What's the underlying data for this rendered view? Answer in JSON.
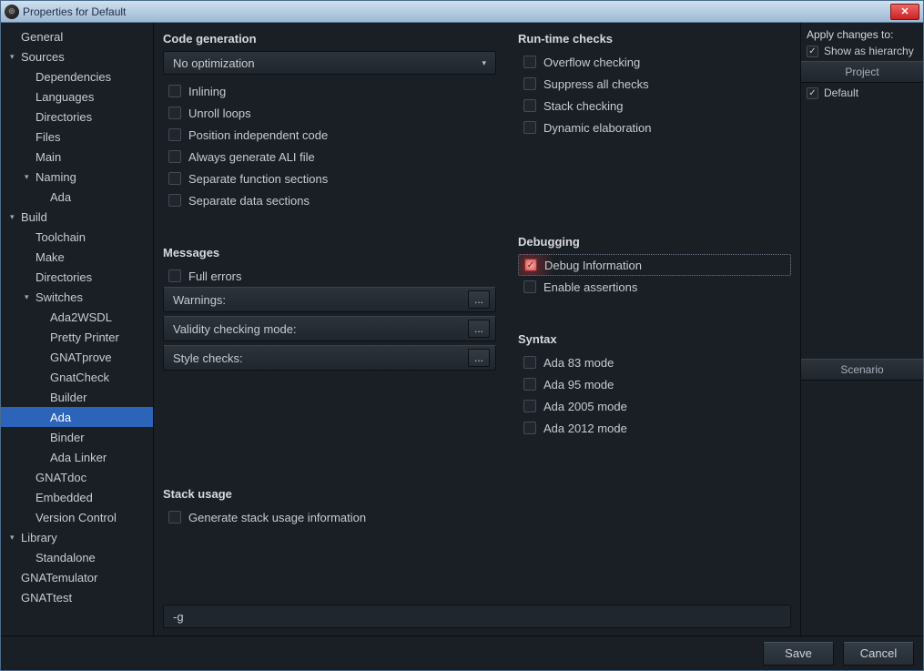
{
  "window": {
    "title": "Properties for Default"
  },
  "sidebar": {
    "items": [
      {
        "label": "General",
        "indent": 0,
        "expand": "none"
      },
      {
        "label": "Sources",
        "indent": 0,
        "expand": "open"
      },
      {
        "label": "Dependencies",
        "indent": 1,
        "expand": "none"
      },
      {
        "label": "Languages",
        "indent": 1,
        "expand": "none"
      },
      {
        "label": "Directories",
        "indent": 1,
        "expand": "none"
      },
      {
        "label": "Files",
        "indent": 1,
        "expand": "none"
      },
      {
        "label": "Main",
        "indent": 1,
        "expand": "none"
      },
      {
        "label": "Naming",
        "indent": 1,
        "expand": "open"
      },
      {
        "label": "Ada",
        "indent": 2,
        "expand": "none"
      },
      {
        "label": "Build",
        "indent": 0,
        "expand": "open"
      },
      {
        "label": "Toolchain",
        "indent": 1,
        "expand": "none"
      },
      {
        "label": "Make",
        "indent": 1,
        "expand": "none"
      },
      {
        "label": "Directories",
        "indent": 1,
        "expand": "none"
      },
      {
        "label": "Switches",
        "indent": 1,
        "expand": "open"
      },
      {
        "label": "Ada2WSDL",
        "indent": 2,
        "expand": "none"
      },
      {
        "label": "Pretty Printer",
        "indent": 2,
        "expand": "none"
      },
      {
        "label": "GNATprove",
        "indent": 2,
        "expand": "none"
      },
      {
        "label": "GnatCheck",
        "indent": 2,
        "expand": "none"
      },
      {
        "label": "Builder",
        "indent": 2,
        "expand": "none"
      },
      {
        "label": "Ada",
        "indent": 2,
        "expand": "none",
        "selected": true
      },
      {
        "label": "Binder",
        "indent": 2,
        "expand": "none"
      },
      {
        "label": "Ada Linker",
        "indent": 2,
        "expand": "none"
      },
      {
        "label": "GNATdoc",
        "indent": 1,
        "expand": "none"
      },
      {
        "label": "Embedded",
        "indent": 1,
        "expand": "none"
      },
      {
        "label": "Version Control",
        "indent": 1,
        "expand": "none"
      },
      {
        "label": "Library",
        "indent": 0,
        "expand": "open"
      },
      {
        "label": "Standalone",
        "indent": 1,
        "expand": "none"
      },
      {
        "label": "GNATemulator",
        "indent": 0,
        "expand": "none"
      },
      {
        "label": "GNATtest",
        "indent": 0,
        "expand": "none"
      }
    ]
  },
  "codegen": {
    "heading": "Code generation",
    "optimization": "No optimization",
    "checks": [
      {
        "label": "Inlining",
        "checked": false
      },
      {
        "label": "Unroll loops",
        "checked": false
      },
      {
        "label": "Position independent code",
        "checked": false
      },
      {
        "label": "Always generate ALI file",
        "checked": false
      },
      {
        "label": "Separate function sections",
        "checked": false
      },
      {
        "label": "Separate data sections",
        "checked": false
      }
    ]
  },
  "runtime": {
    "heading": "Run-time checks",
    "checks": [
      {
        "label": "Overflow checking",
        "checked": false
      },
      {
        "label": "Suppress all checks",
        "checked": false
      },
      {
        "label": "Stack checking",
        "checked": false
      },
      {
        "label": "Dynamic elaboration",
        "checked": false
      }
    ]
  },
  "messages": {
    "heading": "Messages",
    "full_errors": {
      "label": "Full errors",
      "checked": false
    },
    "rows": [
      {
        "label": "Warnings:"
      },
      {
        "label": "Validity checking mode:"
      },
      {
        "label": "Style checks:"
      }
    ]
  },
  "debugging": {
    "heading": "Debugging",
    "checks": [
      {
        "label": "Debug Information",
        "checked": true,
        "highlight": true
      },
      {
        "label": "Enable assertions",
        "checked": false
      }
    ]
  },
  "syntax": {
    "heading": "Syntax",
    "checks": [
      {
        "label": "Ada 83 mode",
        "checked": false
      },
      {
        "label": "Ada 95 mode",
        "checked": false
      },
      {
        "label": "Ada 2005 mode",
        "checked": false
      },
      {
        "label": "Ada 2012 mode",
        "checked": false
      }
    ]
  },
  "stack": {
    "heading": "Stack usage",
    "check": {
      "label": "Generate stack usage information",
      "checked": false
    }
  },
  "cmdline": "-g",
  "rightpane": {
    "apply_label": "Apply changes to:",
    "show_hierarchy": {
      "label": "Show as hierarchy",
      "checked": true
    },
    "project_header": "Project",
    "projects": [
      {
        "label": "Default",
        "checked": true
      }
    ],
    "scenario_header": "Scenario"
  },
  "buttons": {
    "save": "Save",
    "cancel": "Cancel"
  },
  "glyphs": {
    "ellipsis": "...",
    "caret_open": "▾",
    "caret_closed": "▸",
    "dd_arrow": "▾",
    "close": "✕"
  }
}
